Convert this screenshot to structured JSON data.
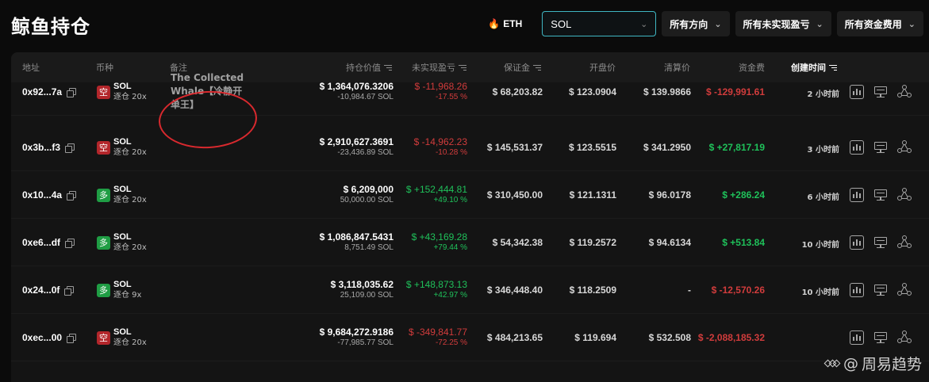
{
  "page": {
    "title": "鲸鱼持仓"
  },
  "toolbar": {
    "eth_label": "ETH",
    "eth_icon": "flame-icon",
    "coin_select": {
      "value": "SOL"
    },
    "direction_filter": "所有方向",
    "pnl_filter": "所有未实现盈亏",
    "funding_filter": "所有资金费用"
  },
  "table": {
    "headers": {
      "address": "地址",
      "coin": "币种",
      "note": "备注",
      "position_value": "持仓价值",
      "unrealized_pnl": "未实现盈亏",
      "margin": "保证金",
      "entry_price": "开盘价",
      "liq_price": "清算价",
      "funding": "资金费",
      "created": "创建时间"
    },
    "rows": [
      {
        "address": "0x92...7a",
        "side": "空",
        "side_type": "short",
        "coin": "SOL",
        "leverage": "逐仓 20x",
        "note": "The Collected Whale【冷静开单王】",
        "value": "$ 1,364,076.3206",
        "size": "-10,984.67 SOL",
        "pnl": "$ -11,968.26",
        "pnl_pct": "-17.55 %",
        "pnl_sign": "neg",
        "margin": "$ 68,203.82",
        "entry": "$ 123.0904",
        "liq": "$ 139.9866",
        "funding": "$ -129,991.61",
        "funding_sign": "neg",
        "time": "2 小时前"
      },
      {
        "address": "0x3b...f3",
        "side": "空",
        "side_type": "short",
        "coin": "SOL",
        "leverage": "逐仓 20x",
        "note": "",
        "value": "$ 2,910,627.3691",
        "size": "-23,436.89 SOL",
        "pnl": "$ -14,962.23",
        "pnl_pct": "-10.28 %",
        "pnl_sign": "neg",
        "margin": "$ 145,531.37",
        "entry": "$ 123.5515",
        "liq": "$ 341.2950",
        "funding": "$ +27,817.19",
        "funding_sign": "pos",
        "time": "3 小时前"
      },
      {
        "address": "0x10...4a",
        "side": "多",
        "side_type": "long",
        "coin": "SOL",
        "leverage": "逐仓 20x",
        "note": "",
        "value": "$ 6,209,000",
        "size": "50,000.00 SOL",
        "pnl": "$ +152,444.81",
        "pnl_pct": "+49.10 %",
        "pnl_sign": "pos",
        "margin": "$ 310,450.00",
        "entry": "$ 121.1311",
        "liq": "$ 96.0178",
        "funding": "$ +286.24",
        "funding_sign": "pos",
        "time": "6 小时前"
      },
      {
        "address": "0xe6...df",
        "side": "多",
        "side_type": "long",
        "coin": "SOL",
        "leverage": "逐仓 20x",
        "note": "",
        "value": "$ 1,086,847.5431",
        "size": "8,751.49 SOL",
        "pnl": "$ +43,169.28",
        "pnl_pct": "+79.44 %",
        "pnl_sign": "pos",
        "margin": "$ 54,342.38",
        "entry": "$ 119.2572",
        "liq": "$ 94.6134",
        "funding": "$ +513.84",
        "funding_sign": "pos",
        "time": "10 小时前"
      },
      {
        "address": "0x24...0f",
        "side": "多",
        "side_type": "long",
        "coin": "SOL",
        "leverage": "逐仓 9x",
        "note": "",
        "value": "$ 3,118,035.62",
        "size": "25,109.00 SOL",
        "pnl": "$ +148,873.13",
        "pnl_pct": "+42.97 %",
        "pnl_sign": "pos",
        "margin": "$ 346,448.40",
        "entry": "$ 118.2509",
        "liq": "-",
        "funding": "$ -12,570.26",
        "funding_sign": "neg",
        "time": "10 小时前"
      },
      {
        "address": "0xec...00",
        "side": "空",
        "side_type": "short",
        "coin": "SOL",
        "leverage": "逐仓 20x",
        "note": "",
        "value": "$ 9,684,272.9186",
        "size": "-77,985.77 SOL",
        "pnl": "$ -349,841.77",
        "pnl_pct": "-72.25 %",
        "pnl_sign": "neg",
        "margin": "$ 484,213.65",
        "entry": "$ 119.694",
        "liq": "$ 532.508",
        "funding": "$ -2,088,185.32",
        "funding_sign": "neg",
        "time": ""
      }
    ]
  },
  "watermark": {
    "at": "@",
    "text": "周易趋势"
  },
  "colors": {
    "positive": "#1fc15a",
    "negative": "#d13c3c",
    "accent": "#3fb6c2",
    "short_badge": "#b3262b",
    "long_badge": "#1f9d44"
  }
}
